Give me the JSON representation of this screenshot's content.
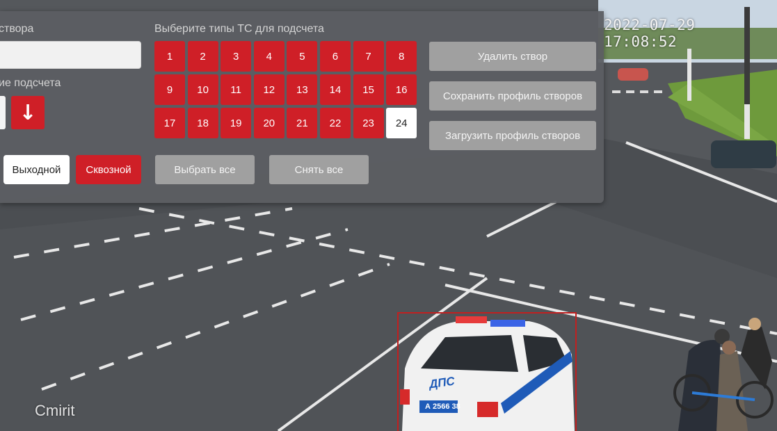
{
  "camera": {
    "timestamp": "2022-07-29 17:08:52",
    "watermark": "Cmirit",
    "car_label": "ДПС",
    "plate": "А 2566 38"
  },
  "panel": {
    "name_label": "створа",
    "direction_label": "ие подсчета",
    "arrow_down": "↓",
    "arrow_up": "↑",
    "types_label": "Выберите типы ТС для подсчета",
    "vehicle_types": [
      "1",
      "2",
      "3",
      "4",
      "5",
      "6",
      "7",
      "8",
      "9",
      "10",
      "11",
      "12",
      "13",
      "14",
      "15",
      "16",
      "17",
      "18",
      "19",
      "20",
      "21",
      "22",
      "23",
      "24"
    ],
    "vehicle_types_selected": [
      true,
      true,
      true,
      true,
      true,
      true,
      true,
      true,
      true,
      true,
      true,
      true,
      true,
      true,
      true,
      true,
      true,
      true,
      true,
      true,
      true,
      true,
      true,
      false
    ],
    "exit_button": "Выходной",
    "through_button": "Сквозной",
    "select_all": "Выбрать все",
    "clear_all": "Снять все",
    "delete_gate": "Удалить створ",
    "save_profile": "Сохранить профиль створов",
    "load_profile": "Загрузить профиль створов"
  },
  "colors": {
    "accent_red": "#cf1f27",
    "panel_bg": "#5c5e62",
    "grey_button": "#a0a0a0"
  }
}
